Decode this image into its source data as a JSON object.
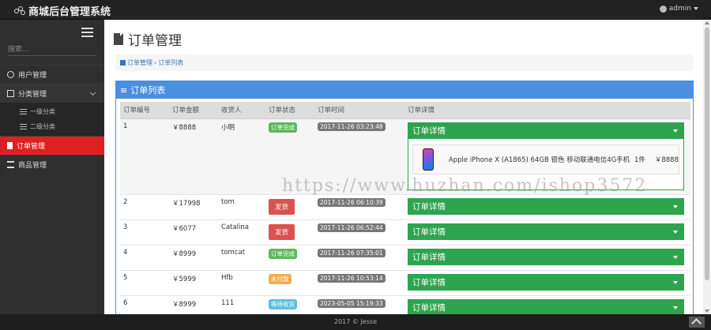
{
  "app": {
    "title": "商城后台管理系统",
    "user": "admin"
  },
  "sidebar": {
    "search_placeholder": "搜索...",
    "items": [
      {
        "label": "用户管理",
        "icon": "user-icon"
      },
      {
        "label": "分类管理",
        "icon": "category-icon",
        "children": [
          "一级分类",
          "二级分类"
        ]
      },
      {
        "label": "订单管理",
        "icon": "file-icon",
        "active": true
      },
      {
        "label": "商品管理",
        "icon": "bank-icon"
      }
    ]
  },
  "main": {
    "title": "订单管理",
    "breadcrumb": [
      "订单管理",
      "订单列表"
    ],
    "panel_title": "订单列表",
    "columns": [
      "订单编号",
      "订单金额",
      "收货人",
      "订单状态",
      "订单时间",
      "订单详情"
    ],
    "detail_label": "订单详情",
    "orders": [
      {
        "id": "1",
        "amount": "￥8888",
        "receiver": "小明",
        "status": "订单完成",
        "status_type": "done",
        "time": "2017-11-26 03:23:48"
      },
      {
        "id": "2",
        "amount": "￥17998",
        "receiver": "tom",
        "status": "发货",
        "status_type": "ship",
        "time": "2017-11-26 06:10:39"
      },
      {
        "id": "3",
        "amount": "￥6077",
        "receiver": "Catalina",
        "status": "发货",
        "status_type": "ship",
        "time": "2017-11-26 06:52:44"
      },
      {
        "id": "4",
        "amount": "￥8999",
        "receiver": "tomcat",
        "status": "订单完成",
        "status_type": "done",
        "time": "2017-11-26 07:35:01"
      },
      {
        "id": "5",
        "amount": "￥5999",
        "receiver": "Hfb",
        "status": "未付款",
        "status_type": "unpaid",
        "time": "2017-11-26 10:53:14"
      },
      {
        "id": "6",
        "amount": "￥8999",
        "receiver": "111",
        "status": "等待收货",
        "status_type": "waiting",
        "time": "2023-05-05 15:19:33"
      }
    ],
    "expanded_detail": {
      "product": "Apple iPhone X (A1865) 64GB 银色 移动联通电信4G手机",
      "qty": "1件",
      "price": "￥8888"
    }
  },
  "watermark": "https://www.huzhan.com/ishop3572",
  "footer": "2017 © Jesse"
}
